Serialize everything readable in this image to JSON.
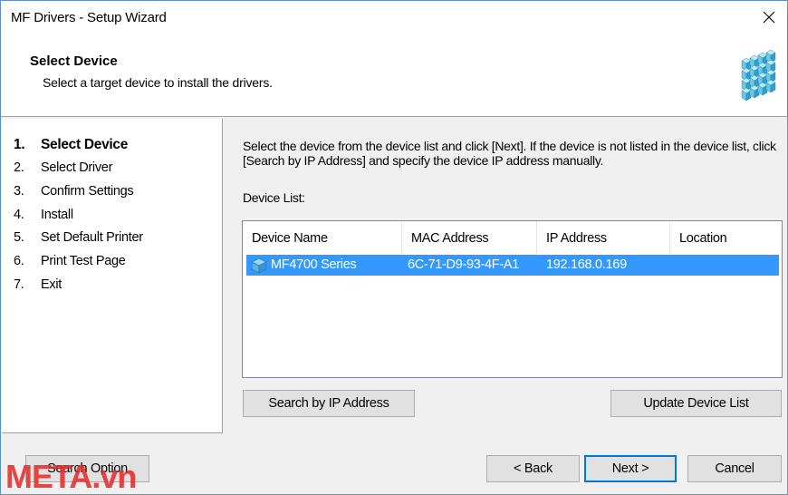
{
  "window": {
    "title": "MF Drivers - Setup Wizard"
  },
  "header": {
    "title": "Select Device",
    "subtitle": "Select a target device to install the drivers.",
    "logo_icon": "cube-grid-logo-icon"
  },
  "steps": [
    {
      "num": "1.",
      "label": "Select Device",
      "active": true
    },
    {
      "num": "2.",
      "label": "Select Driver",
      "active": false
    },
    {
      "num": "3.",
      "label": "Confirm Settings",
      "active": false
    },
    {
      "num": "4.",
      "label": "Install",
      "active": false
    },
    {
      "num": "5.",
      "label": "Set Default Printer",
      "active": false
    },
    {
      "num": "6.",
      "label": "Print Test Page",
      "active": false
    },
    {
      "num": "7.",
      "label": "Exit",
      "active": false
    }
  ],
  "content": {
    "instructions": "Select the device from the device list and click [Next]. If the device is not listed in the device list, click [Search by IP Address] and specify the device IP address manually.",
    "list_label": "Device List:",
    "columns": [
      "Device Name",
      "MAC Address",
      "IP Address",
      "Location"
    ],
    "devices": [
      {
        "name": "MF4700 Series",
        "mac": "6C-71-D9-93-4F-A1",
        "ip": "192.168.0.169",
        "location": "",
        "selected": true
      }
    ],
    "search_ip_label": "Search by IP Address",
    "update_list_label": "Update Device List"
  },
  "footer": {
    "search_option_label": "Search Option",
    "back_label": "< Back",
    "next_label": "Next >",
    "cancel_label": "Cancel"
  },
  "watermark": {
    "text": "META.vn",
    "color": "#e82424"
  },
  "colors": {
    "selection": "#3399ff",
    "focus_border": "#0078d7",
    "window_border": "#5b8fc7"
  }
}
